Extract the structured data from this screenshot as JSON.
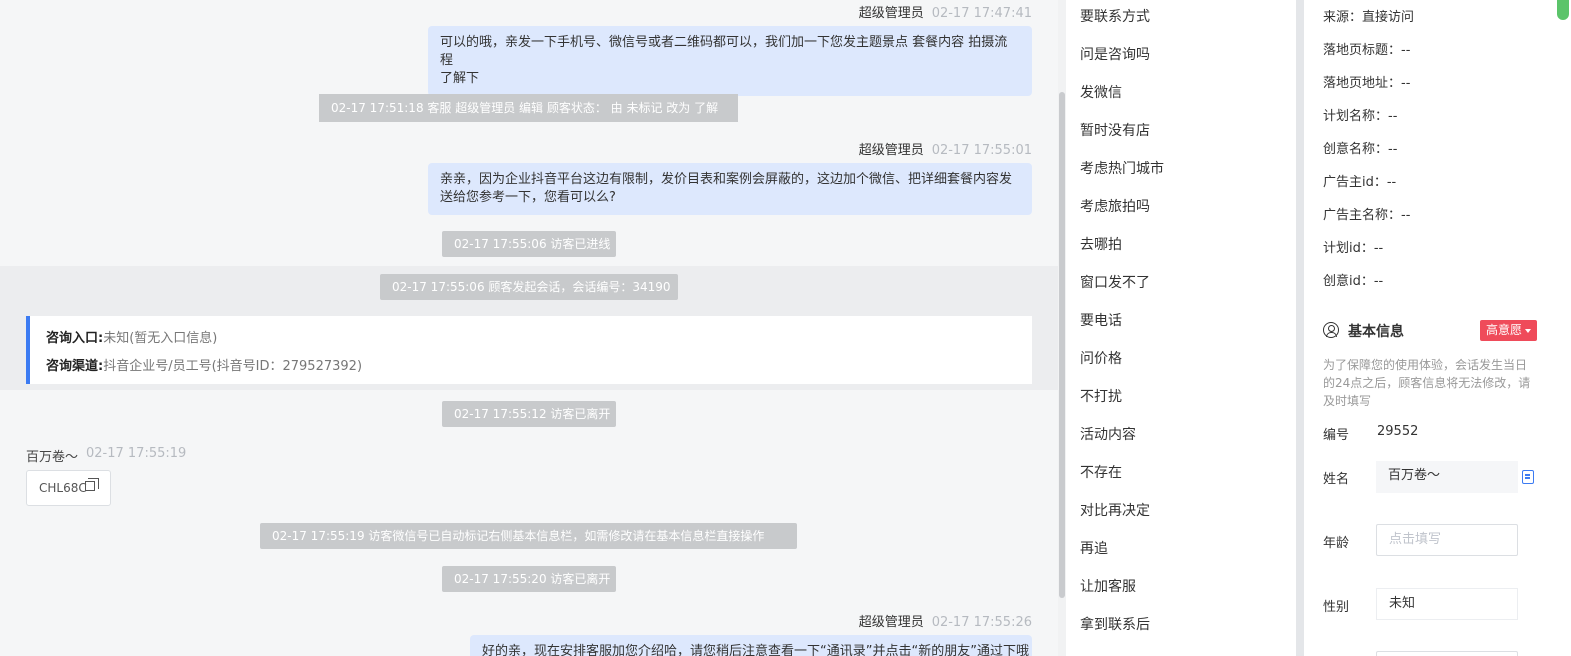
{
  "chat": {
    "msg1": {
      "sender": "超级管理员",
      "time": "02-17 17:47:41",
      "text_line1": "可以的哦，亲发一下手机号、微信号或者二维码都可以，我们加一下您发主题景点 套餐内容 拍摄流程",
      "text_line2": "了解下"
    },
    "sys1": "02-17 17:51:18 客服 超级管理员 编辑 顾客状态： 由 未标记 改为 了解",
    "msg2": {
      "sender": "超级管理员",
      "time": "02-17 17:55:01",
      "text_line1": "亲亲，因为企业抖音平台这边有限制，发价目表和案例会屏蔽的，这边加个微信、把详细套餐内容发",
      "text_line2": "送给您参考一下，您看可以么?"
    },
    "sys2": "02-17 17:55:06 访客已进线",
    "sys3": "02-17 17:55:06 顾客发起会话，会话编号：34190",
    "entry": {
      "entry_label": "咨询入口:",
      "entry_value": "未知(暂无入口信息)",
      "channel_label": "咨询渠道:",
      "channel_value": "抖音企业号/员工号(抖音号ID：279527392)"
    },
    "sys4": "02-17 17:55:12 访客已离开",
    "visitor": {
      "name": "百万卷～",
      "time": "02-17 17:55:19",
      "wechat": "CHL68C"
    },
    "sys5": "02-17 17:55:19 访客微信号已自动标记右侧基本信息栏，如需修改请在基本信息栏直接操作",
    "sys6": "02-17 17:55:20 访客已离开",
    "msg3": {
      "sender": "超级管理员",
      "time": "02-17 17:55:26",
      "text_line1": "好的亲，现在安排客服加您介绍哈，请您稍后注意查看一下“通讯录”并点击“新的朋友”通过下哦"
    }
  },
  "tags": [
    "要联系方式",
    "问是咨询吗",
    "发微信",
    "暂时没有店",
    "考虑热门城市",
    "考虑旅拍吗",
    "去哪拍",
    "窗口发不了",
    "要电话",
    "问价格",
    "不打扰",
    "活动内容",
    "不存在",
    "对比再决定",
    "再追",
    "让加客服",
    "拿到联系后"
  ],
  "info": {
    "source": [
      "来源：直接访问",
      "落地页标题：--",
      "落地页地址：--",
      "计划名称：--",
      "创意名称：--",
      "广告主id：--",
      "广告主名称：--",
      "计划id：--",
      "创意id：--"
    ],
    "basic_title": "基本信息",
    "intent_badge": "高意愿",
    "notice": "为了保障您的使用体验，会话发生当日的24点之后，顾客信息将无法修改，请及时填写",
    "fields": {
      "id_label": "编号",
      "id_value": "29552",
      "name_label": "姓名",
      "name_value": "百万卷～",
      "age_label": "年龄",
      "age_placeholder": "点击填写",
      "sex_label": "性别",
      "sex_value": "未知"
    }
  },
  "colors": {
    "accent": "#3c7bf2",
    "bubble": "#dde8fd",
    "system": "#c8cacc",
    "badge": "#ef4b5a"
  }
}
